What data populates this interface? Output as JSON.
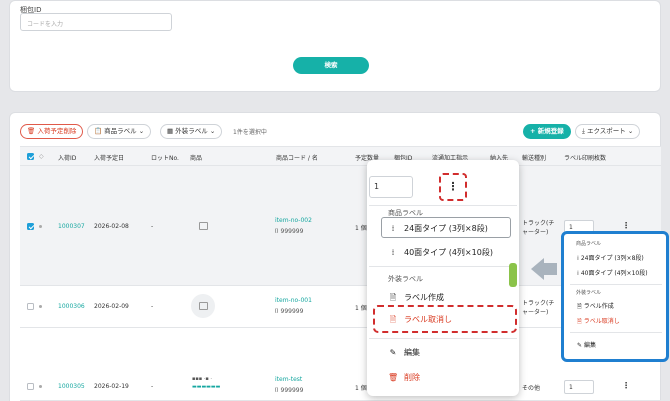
{
  "search": {
    "label": "梱包ID",
    "placeholder": "コードを入力",
    "button": "検索"
  },
  "toolbar": {
    "delete_label": "入荷予定削除",
    "product_label": "商品ラベル",
    "outer_label": "外装ラベル",
    "selected_count": "1件を選択中",
    "new_label": "新規登録",
    "export_label": "エクスポート"
  },
  "table": {
    "headers": [
      "入荷ID",
      "入荷予定日",
      "ロットNo.",
      "商品",
      "商品コード / 名",
      "予定数量",
      "梱包ID",
      "流通加工指示",
      "納入先",
      "輸送種別",
      "ラベル印刷枚数"
    ],
    "rows": [
      {
        "id": "1000307",
        "date": "2026-02-08",
        "lot": "-",
        "code": "item-no-002",
        "jan": "999999",
        "qty": "1 個",
        "transport_1": "トラック(チ",
        "transport_2": "ャーター)",
        "print_qty": "1",
        "checked": true
      },
      {
        "id": "1000306",
        "date": "2026-02-09",
        "lot": "-",
        "code": "item-no-001",
        "jan": "999999",
        "qty": "1 個",
        "transport_1": "トラック(チ",
        "transport_2": "ャーター)",
        "print_qty": "",
        "checked": false
      },
      {
        "id": "1000305",
        "date": "2026-02-19",
        "lot": "-",
        "code": "item-test",
        "jan": "999999",
        "qty": "1 個",
        "transport_1": "その他",
        "transport_2": "",
        "print_qty": "1",
        "checked": false
      }
    ]
  },
  "dropdown": {
    "qty_value": "1",
    "product_label_section": "商品ラベル",
    "type24": "24面タイプ (3列×8段)",
    "type40": "40面タイプ (4列×10段)",
    "outer_label_section": "外装ラベル",
    "create_label": "ラベル作成",
    "cancel_label": "ラベル取消し",
    "edit": "編集",
    "delete": "削除"
  },
  "reference": {
    "product_label_section": "商品ラベル",
    "type24": "24面タイプ (3列×8段)",
    "type40": "40面タイプ (4列×10段)",
    "outer_label_section": "外装ラベル",
    "create_label": "ラベル作成",
    "cancel_label": "ラベル取消し",
    "edit": "編集"
  },
  "colors": {
    "accent": "#16b1a8",
    "danger": "#d9381e",
    "highlight": "#1f7fd0"
  }
}
